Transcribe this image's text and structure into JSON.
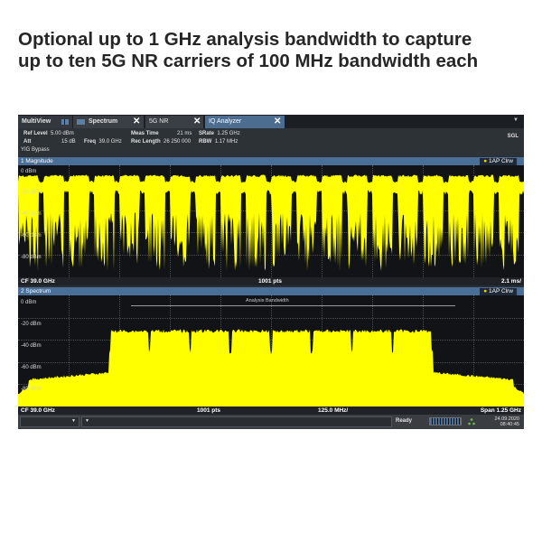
{
  "headline": {
    "line1": "Optional up to 1 GHz analysis bandwidth to capture",
    "line2": "up to ten 5G NR carriers of 100 MHz bandwidth each"
  },
  "tabs": [
    {
      "label": "MultiView",
      "icon": "multiview-icon",
      "active": false
    },
    {
      "label": "Spectrum",
      "icon": "spectrum-icon",
      "active": false
    },
    {
      "label": "5G NR",
      "active": false
    },
    {
      "label": "IQ Analyzer",
      "active": true
    }
  ],
  "tab_close_glyph": "✕",
  "info": {
    "ref_level_label": "Ref Level",
    "ref_level": "5.00 dBm",
    "att_label": "Att",
    "att": "15 dB",
    "freq_label": "Freq",
    "freq": "39.0 GHz",
    "meas_time_label": "Meas Time",
    "meas_time": "21 ms",
    "rec_length_label": "Rec Length",
    "rec_length": "26 250 000",
    "srate_label": "SRate",
    "srate": "1.25 GHz",
    "rbw_label": "RBW",
    "rbw": "1.17 MHz",
    "yig": "YIG Bypass",
    "mode": "SGL"
  },
  "panel1": {
    "title": "1 Magnitude",
    "trace": "1AP Clrw",
    "y_labels": [
      "0 dBm",
      "-20 dBm",
      "-40 dBm",
      "-60 dBm",
      "-80 dBm"
    ],
    "footer_left": "CF 39.0 GHz",
    "footer_mid": "1001 pts",
    "footer_right": "2.1 ms/"
  },
  "panel2": {
    "title": "2 Spectrum",
    "trace": "1AP Clrw",
    "annotation": "Analysis Bandwidth",
    "y_labels": [
      "0 dBm",
      "-20 dBm",
      "-40 dBm",
      "-60 dBm",
      "-80 dBm"
    ],
    "footer_left": "CF 39.0 GHz",
    "footer_mid": "1001 pts",
    "footer_mid2": "125.0 MHz/",
    "footer_right": "Span 1.25 GHz"
  },
  "status": {
    "ready": "Ready",
    "date": "24.09.2020",
    "time": "08:40:45"
  },
  "colors": {
    "trace": "#ffff00",
    "panel_header": "#4a6e96",
    "active_tab": "#4c6d90",
    "plot_bg": "#111316"
  },
  "chart_data": [
    {
      "type": "line",
      "title": "1 Magnitude",
      "ylabel": "dBm",
      "ylim": [
        -90,
        5
      ],
      "y_ticks": [
        0,
        -20,
        -40,
        -60,
        -80
      ],
      "x_label": "1001 pts",
      "x_scale": "2.1 ms/",
      "center": "CF 39.0 GHz",
      "series": [
        {
          "name": "1AP Clrw",
          "burst_count": 20,
          "burst_level_dbm": -3,
          "gap_level_dbm": -9,
          "noise_floor_dbm": -55,
          "noise_peaks_dbm": -35
        }
      ]
    },
    {
      "type": "area",
      "title": "2 Spectrum",
      "ylabel": "dBm",
      "ylim": [
        -90,
        5
      ],
      "y_ticks": [
        0,
        -20,
        -40,
        -60,
        -80
      ],
      "span": "Span 1.25 GHz",
      "center": "CF 39.0 GHz",
      "x_scale": "125.0 MHz/",
      "x_range_mhz": [
        -625,
        625
      ],
      "series": [
        {
          "name": "1AP Clrw",
          "carrier_count": 8,
          "carrier_bandwidth_mhz": 100,
          "carrier_level_dbm": -24,
          "shoulder_level_dbm": -62,
          "floor_level_dbm": -86,
          "analysis_bandwidth_mhz": [
            -400,
            400
          ]
        }
      ]
    }
  ]
}
